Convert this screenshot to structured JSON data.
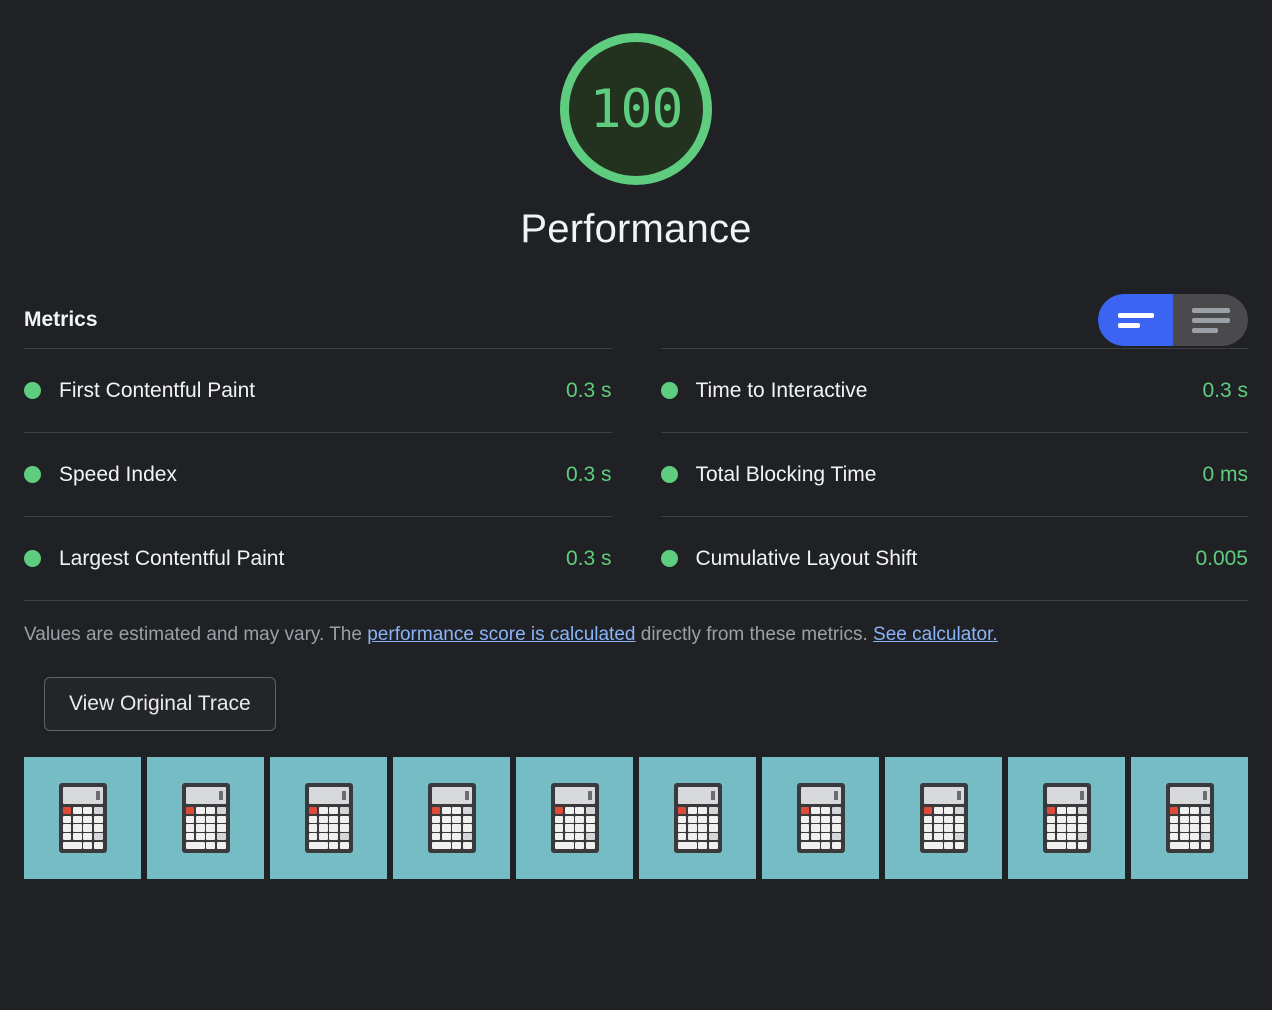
{
  "gauge": {
    "score": "100",
    "category": "Performance",
    "ring_color": "#5fcd7f",
    "fill_color": "#23311f"
  },
  "metrics_section": {
    "title": "Metrics",
    "toggle": {
      "simple_view": "simple-view-toggle",
      "expanded_view": "expanded-view-toggle",
      "active": "simple",
      "active_color": "#3b64f2",
      "inactive_color": "#4a4a4c"
    },
    "left_column": [
      {
        "label": "First Contentful Paint",
        "value": "0.3 s",
        "status": "pass"
      },
      {
        "label": "Speed Index",
        "value": "0.3 s",
        "status": "pass"
      },
      {
        "label": "Largest Contentful Paint",
        "value": "0.3 s",
        "status": "pass"
      }
    ],
    "right_column": [
      {
        "label": "Time to Interactive",
        "value": "0.3 s",
        "status": "pass"
      },
      {
        "label": "Total Blocking Time",
        "value": "0 ms",
        "status": "pass"
      },
      {
        "label": "Cumulative Layout Shift",
        "value": "0.005",
        "status": "pass"
      }
    ],
    "pass_color": "#5fcd7f"
  },
  "footnote": {
    "part1": "Values are estimated and may vary. The ",
    "link1": "performance score is calculated",
    "part2": " directly from these metrics. ",
    "link2": "See calculator.",
    "link_color": "#8ab4f8"
  },
  "trace_button": {
    "label": "View Original Trace"
  },
  "filmstrip": {
    "background_color": "#76bcc5",
    "frames": [
      {
        "name": "filmstrip-frame-1"
      },
      {
        "name": "filmstrip-frame-2"
      },
      {
        "name": "filmstrip-frame-3"
      },
      {
        "name": "filmstrip-frame-4"
      },
      {
        "name": "filmstrip-frame-5"
      },
      {
        "name": "filmstrip-frame-6"
      },
      {
        "name": "filmstrip-frame-7"
      },
      {
        "name": "filmstrip-frame-8"
      },
      {
        "name": "filmstrip-frame-9"
      },
      {
        "name": "filmstrip-frame-10"
      }
    ]
  }
}
